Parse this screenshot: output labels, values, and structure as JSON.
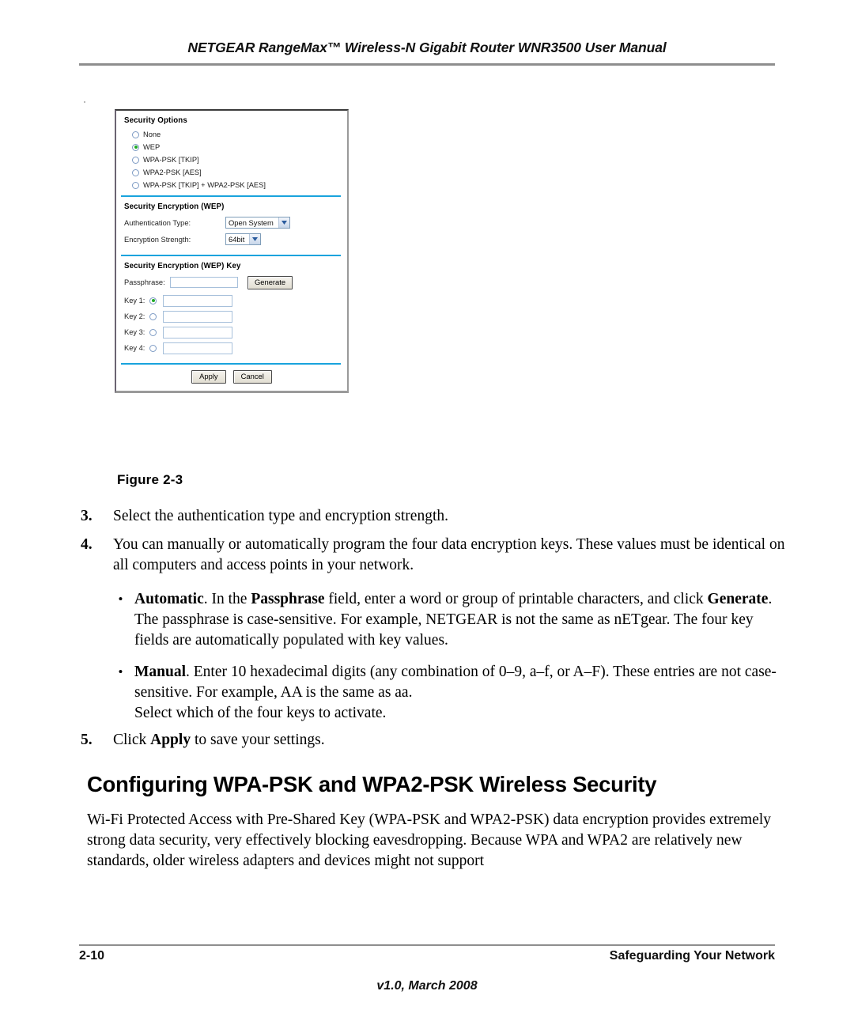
{
  "header": {
    "title": "NETGEAR RangeMax™ Wireless-N Gigabit Router WNR3500 User Manual"
  },
  "figure": {
    "caption": "Figure 2-3",
    "accent_color": "#19a3dd",
    "radio_selected_color": "#1faa25",
    "security_options": {
      "title": "Security Options",
      "options": [
        {
          "label": "None",
          "selected": false
        },
        {
          "label": "WEP",
          "selected": true
        },
        {
          "label": "WPA-PSK [TKIP]",
          "selected": false
        },
        {
          "label": "WPA2-PSK [AES]",
          "selected": false
        },
        {
          "label": "WPA-PSK [TKIP] + WPA2-PSK [AES]",
          "selected": false
        }
      ]
    },
    "security_encryption": {
      "title": "Security Encryption (WEP)",
      "auth_type_label": "Authentication Type:",
      "auth_type_value": "Open System",
      "encryption_strength_label": "Encryption Strength:",
      "encryption_strength_value": "64bit"
    },
    "wep_key": {
      "title": "Security Encryption (WEP) Key",
      "passphrase_label": "Passphrase:",
      "passphrase_value": "",
      "generate_label": "Generate",
      "keys": [
        {
          "label": "Key 1:",
          "selected": true,
          "value": ""
        },
        {
          "label": "Key 2:",
          "selected": false,
          "value": ""
        },
        {
          "label": "Key 3:",
          "selected": false,
          "value": ""
        },
        {
          "label": "Key 4:",
          "selected": false,
          "value": ""
        }
      ]
    },
    "actions": {
      "apply_label": "Apply",
      "cancel_label": "Cancel"
    }
  },
  "body": {
    "step3": {
      "number": "3.",
      "text": "Select the authentication type and encryption strength."
    },
    "step4": {
      "number": "4.",
      "text": "You can manually or automatically program the four data encryption keys. These values must be identical on all computers and access points in your network."
    },
    "bullet_automatic": {
      "marker": "•",
      "lead": "Automatic",
      "text_1": ". In the ",
      "emphasis_1": "Passphrase",
      "text_2": " field, enter a word or group of printable characters, and click ",
      "emphasis_2": "Generate",
      "text_3": ". The passphrase is case-sensitive. For example, NETGEAR is not the same as nETgear. The four key fields are automatically populated with key values."
    },
    "bullet_manual": {
      "marker": "•",
      "lead": "Manual",
      "text_1": ". Enter 10 hexadecimal digits (any combination of 0–9, a–f, or A–F). These entries are not case-sensitive. For example, AA is the same as aa.",
      "text_2": "Select which of the four keys to activate."
    },
    "step5": {
      "number": "5.",
      "text_1": "Click ",
      "emphasis": "Apply",
      "text_2": " to save your settings."
    },
    "section_heading": "Configuring WPA-PSK and WPA2-PSK Wireless Security",
    "section_paragraph": "Wi-Fi Protected Access with Pre-Shared Key (WPA-PSK and WPA2-PSK) data encryption provides extremely strong data security, very effectively blocking eavesdropping. Because WPA and WPA2 are relatively new standards, older wireless adapters and devices might not support"
  },
  "footer": {
    "page_number": "2-10",
    "chapter": "Safeguarding Your Network",
    "version": "v1.0, March 2008"
  }
}
